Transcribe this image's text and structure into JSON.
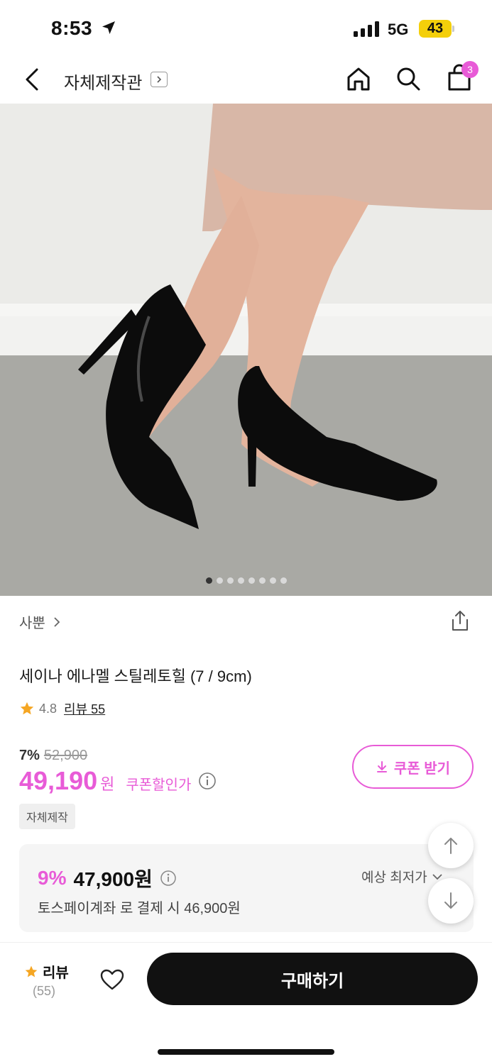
{
  "status": {
    "time": "8:53",
    "network": "5G",
    "battery": "43"
  },
  "nav": {
    "title": "자체제작관",
    "cart_count": "3"
  },
  "carousel": {
    "total": 8,
    "active": 0
  },
  "product": {
    "brand": "사뿐",
    "name": "세이나 에나멜 스틸레토힐 (7 / 9cm)",
    "rating": "4.8",
    "review_label": "리뷰 55"
  },
  "pricing": {
    "discount_pct": "7%",
    "original_price": "52,900",
    "price": "49,190",
    "currency": "원",
    "coupon_price_label": "쿠폰할인가",
    "coupon_button": "쿠폰 받기",
    "tag": "자체제작"
  },
  "best_price": {
    "pct": "9%",
    "price": "47,900원",
    "label": "예상 최저가",
    "note": "토스페이계좌 로 결제 시 46,900원"
  },
  "bottom": {
    "review_label": "리뷰",
    "review_count": "(55)",
    "buy_label": "구매하기"
  },
  "colors": {
    "accent": "#e85bd7",
    "star": "#f5a623",
    "dark": "#111111"
  }
}
